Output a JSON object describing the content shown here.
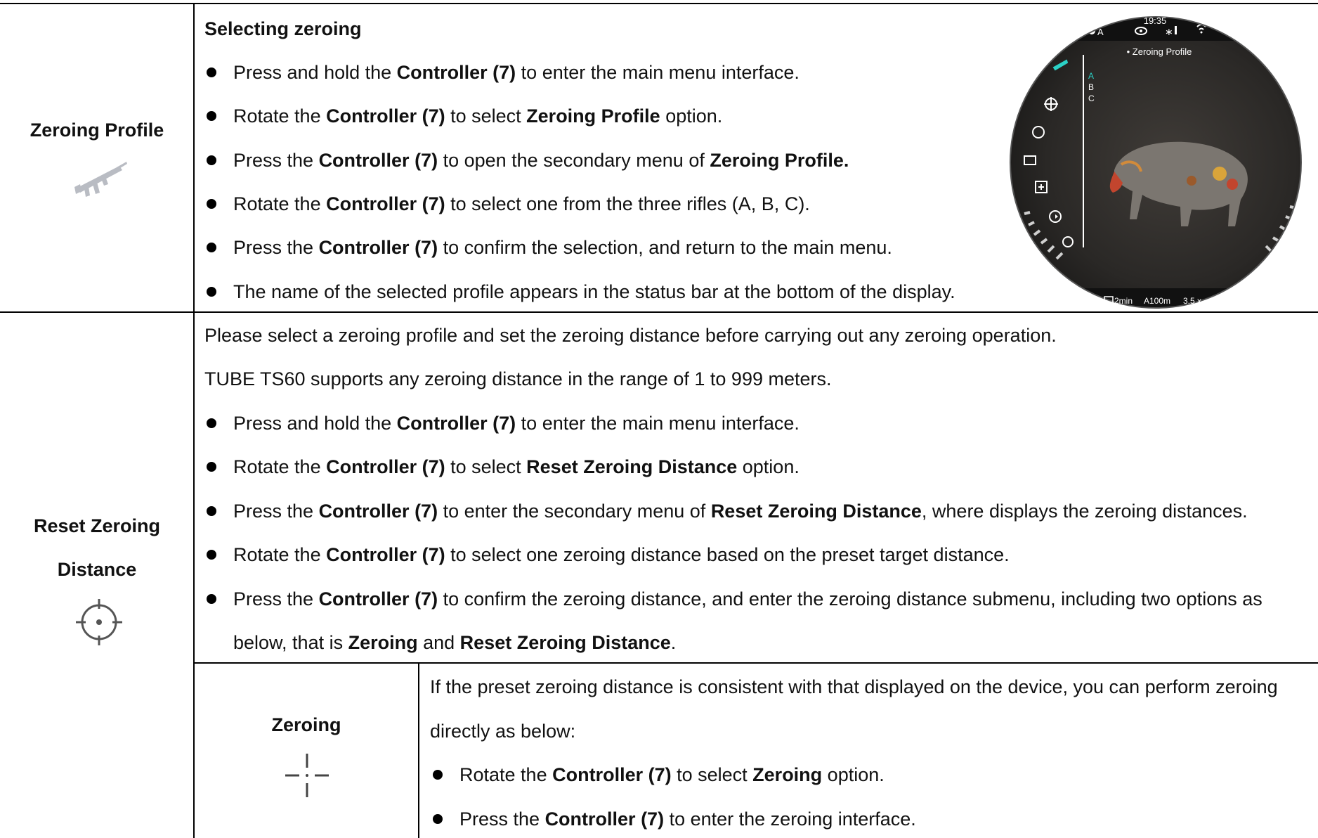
{
  "row1": {
    "label": "Zeroing Profile",
    "heading": "Selecting zeroing",
    "bullets": [
      [
        "Press and hold the ",
        {
          "b": "Controller (7)"
        },
        " to enter the main menu interface."
      ],
      [
        "Rotate the ",
        {
          "b": "Controller (7)"
        },
        " to select ",
        {
          "b": "Zeroing Profile"
        },
        " option."
      ],
      [
        "Press the ",
        {
          "b": "Controller (7)"
        },
        " to open the secondary menu of ",
        {
          "b": "Zeroing Profile."
        }
      ],
      [
        "Rotate the ",
        {
          "b": "Controller (7)"
        },
        " to select one from the three rifles (A, B, C)."
      ],
      [
        "Press the ",
        {
          "b": "Controller (7)"
        },
        " to confirm the selection, and return to the main menu."
      ],
      [
        "The name of the selected profile appears in the status bar at the bottom of the display."
      ]
    ],
    "screen": {
      "time": "19:35",
      "mode": "A",
      "menu_title": "• Zeroing Profile",
      "profiles": [
        "A",
        "B",
        "C"
      ],
      "status_timer": "2min",
      "status_profile": "A100m",
      "status_zoom": "3.5 x"
    }
  },
  "row2": {
    "label_line1": "Reset Zeroing",
    "label_line2": "Distance",
    "para1": "Please select a zeroing profile and set the zeroing distance before carrying out any zeroing operation.",
    "para2": "TUBE TS60 supports any zeroing distance in the range of 1 to 999 meters.",
    "bullets": [
      [
        "Press and hold the ",
        {
          "b": "Controller (7)"
        },
        " to enter the main menu interface."
      ],
      [
        "Rotate the ",
        {
          "b": "Controller (7)"
        },
        " to select ",
        {
          "b": "Reset Zeroing Distance"
        },
        " option."
      ],
      [
        "Press the ",
        {
          "b": "Controller (7)"
        },
        " to enter the secondary menu of ",
        {
          "b": "Reset Zeroing Distance"
        },
        ", where displays the zeroing distances."
      ],
      [
        "Rotate the ",
        {
          "b": "Controller (7)"
        },
        " to select one zeroing distance based on the preset target distance."
      ],
      [
        "Press the ",
        {
          "b": "Controller (7)"
        },
        " to confirm the zeroing distance, and enter the zeroing distance submenu, including two options as"
      ]
    ],
    "bullet5_cont": [
      "below, that is ",
      {
        "b": "Zeroing"
      },
      " and ",
      {
        "b": "Reset Zeroing Distance"
      },
      "."
    ]
  },
  "row3": {
    "label": "Zeroing",
    "para1": "If the preset zeroing distance is consistent with that displayed on the device, you can perform zeroing",
    "para2": "directly as below:",
    "bullets": [
      [
        "Rotate the ",
        {
          "b": "Controller (7)"
        },
        " to select ",
        {
          "b": "Zeroing"
        },
        " option."
      ],
      [
        "Press the ",
        {
          "b": "Controller (7)"
        },
        " to enter the zeroing interface."
      ]
    ]
  }
}
